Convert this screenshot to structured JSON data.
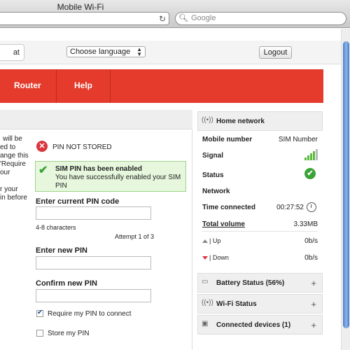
{
  "browser": {
    "window_title": "Mobile Wi-Fi",
    "search_placeholder": "Google"
  },
  "topbar": {
    "left_tab_label": "at",
    "language": "Choose language",
    "logout_label": "Logout"
  },
  "nav": {
    "items": [
      "Router",
      "Help"
    ]
  },
  "left": {
    "cut_text": [
      "will be",
      "ed to",
      "ange this",
      "'Require",
      "our",
      "r your",
      "in before"
    ],
    "pin_status": "PIN NOT STORED",
    "success_title": "SIM PIN has been enabled",
    "success_msg": "You have successfully enabled your SIM PIN",
    "current_pin_label": "Enter current PIN code",
    "hint": "4-8 characters",
    "attempt": "Attempt 1 of 3",
    "new_pin_label": "Enter new PIN",
    "confirm_pin_label": "Confirm new PIN",
    "require_pin_label": "Require my PIN to connect",
    "require_pin_checked": true,
    "store_pin_label": "Store my PIN",
    "store_pin_checked": false
  },
  "right": {
    "home_network": "Home network",
    "mobile_number_label": "Mobile number",
    "mobile_number_value": "SIM Number",
    "signal_label": "Signal",
    "status_label": "Status",
    "network_label": "Network",
    "time_connected_label": "Time connected",
    "time_connected_value": "00:27:52",
    "total_volume_label": "Total volume",
    "total_volume_value": "3.33MB",
    "up_label": "| Up",
    "up_value": "0b/s",
    "down_label": "| Down",
    "down_value": "0b/s",
    "battery_label": "Battery Status (56%)",
    "wifi_label": "Wi-Fi Status",
    "devices_label": "Connected devices (1)"
  },
  "colors": {
    "nav_red": "#e43b2c",
    "success_green": "#3aa336",
    "error_red": "#d9363e"
  }
}
